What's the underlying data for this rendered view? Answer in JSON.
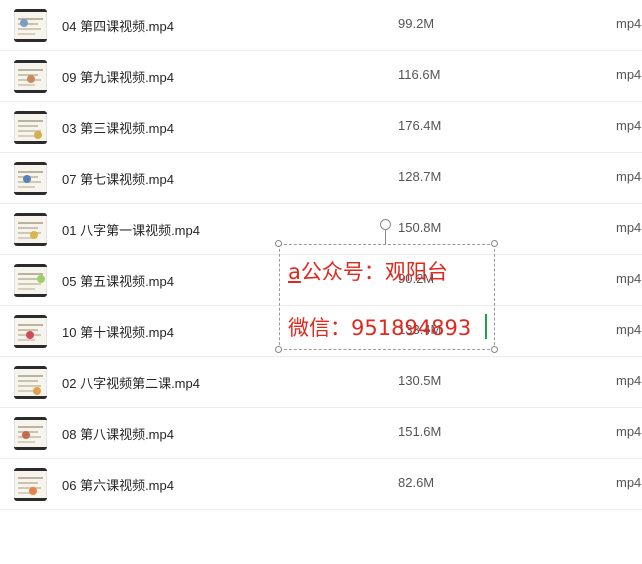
{
  "files": [
    {
      "name": "04 第四课视频.mp4",
      "size": "99.2M",
      "type": "mp4",
      "accent": "#7a9cc9"
    },
    {
      "name": "09 第九课视频.mp4",
      "size": "116.6M",
      "type": "mp4",
      "accent": "#c98b5e"
    },
    {
      "name": "03 第三课视频.mp4",
      "size": "176.4M",
      "type": "mp4",
      "accent": "#d4b04a"
    },
    {
      "name": "07 第七课视频.mp4",
      "size": "128.7M",
      "type": "mp4",
      "accent": "#5a7fbf"
    },
    {
      "name": "01 八字第一课视频.mp4",
      "size": "150.8M",
      "type": "mp4",
      "accent": "#d9b64c"
    },
    {
      "name": "05 第五课视频.mp4",
      "size": "90.2M",
      "type": "mp4",
      "accent": "#9ccf6a"
    },
    {
      "name": "10 第十课视频.mp4",
      "size": "133.4M",
      "type": "mp4",
      "accent": "#d24a5a"
    },
    {
      "name": "02 八字视频第二课.mp4",
      "size": "130.5M",
      "type": "mp4",
      "accent": "#e0a24c"
    },
    {
      "name": "08 第八课视频.mp4",
      "size": "151.6M",
      "type": "mp4",
      "accent": "#c46a4f"
    },
    {
      "name": "06 第六课视频.mp4",
      "size": "82.6M",
      "type": "mp4",
      "accent": "#e8804a"
    }
  ],
  "watermark": {
    "line1_first": "a",
    "line1_rest": "公众号：观阳台",
    "line2": "微信：951894893",
    "color": "#e0281e"
  }
}
